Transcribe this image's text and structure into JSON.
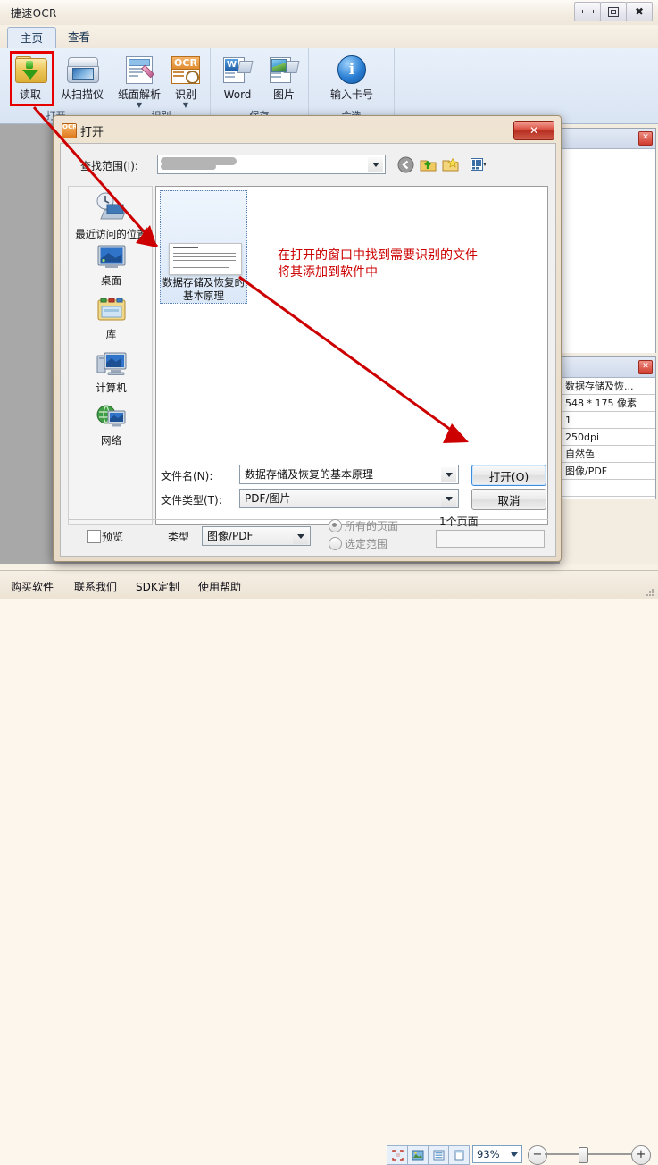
{
  "window": {
    "title": "捷速OCR",
    "controls": {
      "minimize": "–",
      "maximize": "❐",
      "close": "✕"
    }
  },
  "ribbon": {
    "tabs": [
      {
        "label": "主页",
        "active": true
      },
      {
        "label": "查看",
        "active": false
      }
    ],
    "groups": [
      {
        "name": "打开",
        "buttons": [
          {
            "label": "读取",
            "icon": "open-folder-icon",
            "highlighted": true
          },
          {
            "label": "从扫描仪",
            "icon": "scanner-icon"
          }
        ]
      },
      {
        "name": "识别",
        "buttons": [
          {
            "label": "纸面解析",
            "icon": "page-analysis-icon",
            "dropdown": true
          },
          {
            "label": "识别",
            "icon": "ocr-icon",
            "dropdown": true
          }
        ]
      },
      {
        "name": "保存",
        "buttons": [
          {
            "label": "Word",
            "icon": "word-export-icon"
          },
          {
            "label": "图片",
            "icon": "image-export-icon"
          }
        ]
      },
      {
        "name": "会选",
        "buttons": [
          {
            "label": "输入卡号",
            "icon": "info-icon"
          }
        ]
      }
    ]
  },
  "dialog": {
    "title": "打开",
    "icon": "ocr-app-icon",
    "close_label": "✕",
    "lookin": {
      "label": "查找范围(I):",
      "value": ""
    },
    "toolbar_icons": [
      "back-icon",
      "up-folder-icon",
      "new-folder-icon",
      "views-icon"
    ],
    "places": [
      {
        "label": "最近访问的位置",
        "icon": "recent-places-icon"
      },
      {
        "label": "桌面",
        "icon": "desktop-icon"
      },
      {
        "label": "库",
        "icon": "libraries-icon"
      },
      {
        "label": "计算机",
        "icon": "computer-icon"
      },
      {
        "label": "网络",
        "icon": "network-icon"
      }
    ],
    "files": [
      {
        "name_line1": "数据存储及恢复的",
        "name_line2": "基本原理",
        "selected": true
      }
    ],
    "filename": {
      "label": "文件名(N):",
      "value": "数据存储及恢复的基本原理"
    },
    "filetype": {
      "label": "文件类型(T):",
      "value": "PDF/图片"
    },
    "buttons": {
      "open": "打开(O)",
      "cancel": "取消"
    },
    "preview": {
      "label": "预览",
      "checked": false
    },
    "type": {
      "label": "类型",
      "value": "图像/PDF"
    },
    "pages": {
      "all_pages": "所有的页面",
      "selected_range": "选定范围",
      "count_text": "1个页面",
      "range_value": "",
      "selected_option": "all_pages"
    }
  },
  "dock": {
    "thumb_panel": {
      "close_label": "✕"
    },
    "info_panel": {
      "close_label": "✕",
      "rows": [
        "数据存储及恢...",
        "548 * 175 像素",
        "1",
        "250dpi",
        "自然色",
        "图像/PDF",
        ""
      ]
    }
  },
  "statusbar": {
    "links": [
      "购买软件",
      "联系我们",
      "SDK定制",
      "使用帮助"
    ],
    "view_modes": [
      "fit-page-icon",
      "thumbnail-icon",
      "list-icon",
      "single-page-icon"
    ],
    "zoom": {
      "value": "93%",
      "minus": "−",
      "plus": "+"
    }
  },
  "annotations": [
    {
      "text": "在打开的窗口中找到需要识别的文件",
      "color": "#cc0000"
    },
    {
      "text": "将其添加到软件中",
      "color": "#cc0000"
    }
  ],
  "colors": {
    "annotation_red": "#cc0000",
    "highlight_box": "#e60000",
    "workspace_gray": "#a8a8a8",
    "ribbon_blue": "#dfe9f6"
  }
}
